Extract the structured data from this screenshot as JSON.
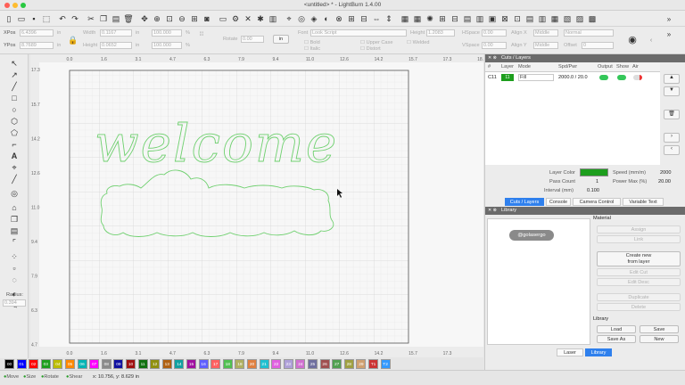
{
  "window": {
    "title": "<untitled> * - LightBurn 1.4.00"
  },
  "toolbar2": {
    "xpos_label": "XPos",
    "xpos_value": "6.4396",
    "ypos_label": "YPos",
    "ypos_value": "8.7689",
    "unit_in": "in",
    "width_label": "Width",
    "width_value": "0.1167",
    "height_label": "Height",
    "height_value": "0.0652",
    "pct_value": "100.000",
    "pct_unit": "%",
    "rotate_label": "Rotate",
    "rotate_value": "0.00",
    "in_button": "in",
    "font_label": "Font",
    "font_value": "Look Script",
    "font_height_label": "Height",
    "font_height_value": "1.2083",
    "hspace_label": "HSpace",
    "hspace_value": "0.00",
    "vspace_label": "VSpace",
    "vspace_value": "0.00",
    "alignx_label": "Align X",
    "alignx_value": "Middle",
    "aligny_label": "Align Y",
    "aligny_value": "Middle",
    "normal_value": "Normal",
    "offset_label": "Offset",
    "offset_value": "0",
    "bold_label": "Bold",
    "italic_label": "Italic",
    "uppercase_label": "Upper Case",
    "distort_label": "Distort",
    "welded_label": "Welded"
  },
  "rulers": {
    "top": [
      "0.0",
      "1.6",
      "3.1",
      "4.7",
      "6.3",
      "7.9",
      "9.4",
      "11.0",
      "12.6",
      "14.2",
      "15.7",
      "17.3",
      "18.9",
      "20.5"
    ],
    "left": [
      "15.7",
      "14.2",
      "12.6",
      "11.0",
      "9.4",
      "7.9",
      "6.3",
      "4.7",
      "3.1"
    ],
    "bottom": [
      "0.0",
      "1.6",
      "3.1",
      "4.7",
      "6.3",
      "7.9",
      "9.4",
      "11.0",
      "12.6",
      "14.2",
      "15.7",
      "17.3"
    ],
    "corner": "17.3"
  },
  "tools": {
    "radius_label": "Radius:",
    "radius_value": "0.394"
  },
  "palette": [
    "00",
    "01",
    "02",
    "03",
    "04",
    "05",
    "06",
    "07",
    "08",
    "09",
    "10",
    "11",
    "12",
    "13",
    "14",
    "15",
    "16",
    "17",
    "18",
    "19",
    "20",
    "21",
    "22",
    "23",
    "24",
    "25",
    "26",
    "27",
    "28",
    "29",
    "T1",
    "T2"
  ],
  "palette_colors": [
    "#000000",
    "#0000ff",
    "#ff0000",
    "#1d9e1d",
    "#bcbc00",
    "#ff8800",
    "#00b4b4",
    "#ff00ff",
    "#8a8a8a",
    "#1010a0",
    "#a01010",
    "#107010",
    "#909010",
    "#b06010",
    "#10a0a0",
    "#a010a0",
    "#6060ff",
    "#ff6060",
    "#50c050",
    "#b0b060",
    "#e08040",
    "#20c0d0",
    "#e060e0",
    "#ae9fd8",
    "#d070d0",
    "#7070a0",
    "#a05050",
    "#50a050",
    "#9fa040",
    "#d0a070",
    "#cc3333",
    "#3399ff"
  ],
  "status": {
    "move": "Move",
    "size": "Size",
    "rotate": "Rotate",
    "shear": "Shear",
    "coords": "x: 10.756, y: 8.629 in"
  },
  "cuts": {
    "title": "Cuts / Layers",
    "headers": [
      "#",
      "Layer",
      "Mode",
      "Spd/Pwr",
      "Output",
      "Show",
      "Air"
    ],
    "row": {
      "num": "C11",
      "layer": "11",
      "mode": "Fill",
      "spdpwr": "2000.0 / 20.0"
    },
    "layer_color_label": "Layer Color",
    "speed_label": "Speed (mm/m)",
    "speed_value": "2000",
    "pass_label": "Pass Count",
    "pass_value": "1",
    "power_label": "Power Max (%)",
    "power_value": "20.00",
    "interval_label": "Interval (mm)",
    "interval_value": "0.100"
  },
  "tabs": [
    "Cuts / Layers",
    "Console",
    "Camera Control",
    "Variable Text"
  ],
  "library": {
    "title": "Library",
    "material_label": "Material",
    "item_text": "@golasergo",
    "assign": "Assign",
    "link": "Link",
    "create_line1": "Create new",
    "create_line2": "from layer",
    "edit_cut": "Edit Cut",
    "edit_desc": "Edit Desc",
    "duplicate": "Duplicate",
    "delete": "Delete",
    "library_label": "Library",
    "load": "Load",
    "save": "Save",
    "save_as": "Save As",
    "new": "New"
  },
  "bottom_tabs": [
    "Laser",
    "Library"
  ],
  "canvas": {
    "design_color": "#6fd06f",
    "design_text": "welcome"
  }
}
